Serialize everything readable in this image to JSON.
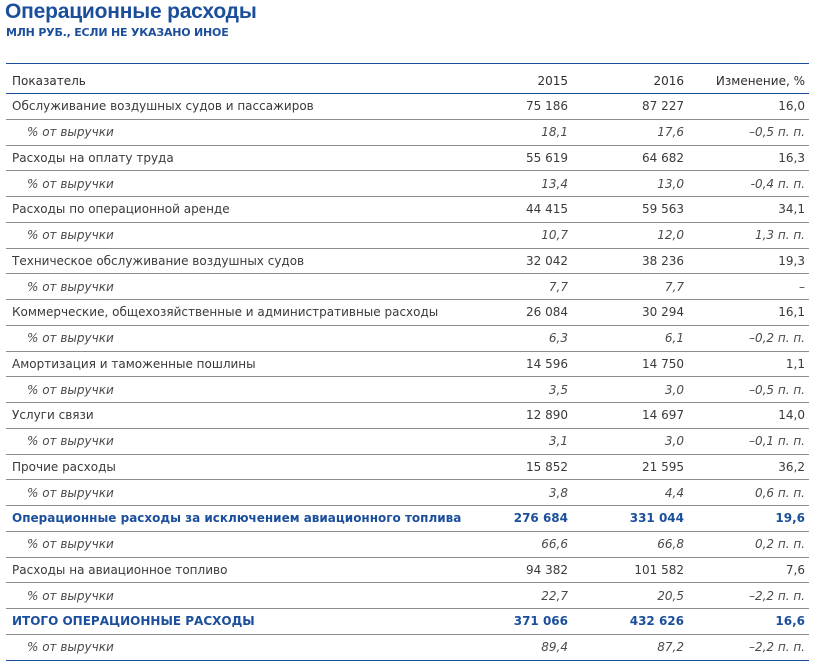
{
  "header": {
    "title": "Операционные расходы",
    "subtitle": "МЛН РУБ., ЕСЛИ НЕ УКАЗАНО ИНОЕ"
  },
  "table": {
    "columns": [
      "Показатель",
      "2015",
      "2016",
      "Изменение, %"
    ],
    "rows": [
      {
        "name": "Обслуживание воздушных судов и пассажиров",
        "v2015": "75 186",
        "v2016": "87 227",
        "change": "16,0",
        "type": "main"
      },
      {
        "name": "% от выручки",
        "v2015": "18,1",
        "v2016": "17,6",
        "change": "–0,5 п. п.",
        "type": "sub"
      },
      {
        "name": "Расходы на оплату труда",
        "v2015": "55 619",
        "v2016": "64 682",
        "change": "16,3",
        "type": "main"
      },
      {
        "name": "% от выручки",
        "v2015": "13,4",
        "v2016": "13,0",
        "change": "-0,4 п. п.",
        "type": "sub"
      },
      {
        "name": "Расходы по операционной аренде",
        "v2015": "44 415",
        "v2016": "59 563",
        "change": "34,1",
        "type": "main"
      },
      {
        "name": "% от выручки",
        "v2015": "10,7",
        "v2016": "12,0",
        "change": "1,3 п. п.",
        "type": "sub"
      },
      {
        "name": "Техническое обслуживание воздушных судов",
        "v2015": "32 042",
        "v2016": "38 236",
        "change": "19,3",
        "type": "main"
      },
      {
        "name": "% от выручки",
        "v2015": "7,7",
        "v2016": "7,7",
        "change": "–",
        "type": "sub"
      },
      {
        "name": "Коммерческие, общехозяйственные и административные расходы",
        "v2015": "26 084",
        "v2016": "30 294",
        "change": "16,1",
        "type": "main"
      },
      {
        "name": "% от выручки",
        "v2015": "6,3",
        "v2016": "6,1",
        "change": "–0,2 п. п.",
        "type": "sub"
      },
      {
        "name": "Амортизация и таможенные пошлины",
        "v2015": "14 596",
        "v2016": "14 750",
        "change": "1,1",
        "type": "main"
      },
      {
        "name": "% от выручки",
        "v2015": "3,5",
        "v2016": "3,0",
        "change": "–0,5 п. п.",
        "type": "sub"
      },
      {
        "name": "Услуги связи",
        "v2015": "12 890",
        "v2016": "14 697",
        "change": "14,0",
        "type": "main"
      },
      {
        "name": "% от выручки",
        "v2015": "3,1",
        "v2016": "3,0",
        "change": "–0,1 п. п.",
        "type": "sub"
      },
      {
        "name": "Прочие расходы",
        "v2015": "15 852",
        "v2016": "21 595",
        "change": "36,2",
        "type": "main"
      },
      {
        "name": "% от выручки",
        "v2015": "3,8",
        "v2016": "4,4",
        "change": "0,6 п. п.",
        "type": "sub"
      },
      {
        "name": "Операционные расходы за исключением авиационного топлива",
        "v2015": "276 684",
        "v2016": "331 044",
        "change": "19,6",
        "type": "total"
      },
      {
        "name": "% от выручки",
        "v2015": "66,6",
        "v2016": "66,8",
        "change": "0,2 п. п.",
        "type": "sub"
      },
      {
        "name": "Расходы на авиационное топливо",
        "v2015": "94 382",
        "v2016": "101 582",
        "change": "7,6",
        "type": "main"
      },
      {
        "name": "% от выручки",
        "v2015": "22,7",
        "v2016": "20,5",
        "change": "–2,2 п. п.",
        "type": "sub"
      },
      {
        "name": "ИТОГО ОПЕРАЦИОННЫЕ РАСХОДЫ",
        "v2015": "371 066",
        "v2016": "432 626",
        "change": "16,6",
        "type": "total"
      },
      {
        "name": "% от выручки",
        "v2015": "89,4",
        "v2016": "87,2",
        "change": "–2,2 п. п.",
        "type": "sub"
      }
    ]
  }
}
